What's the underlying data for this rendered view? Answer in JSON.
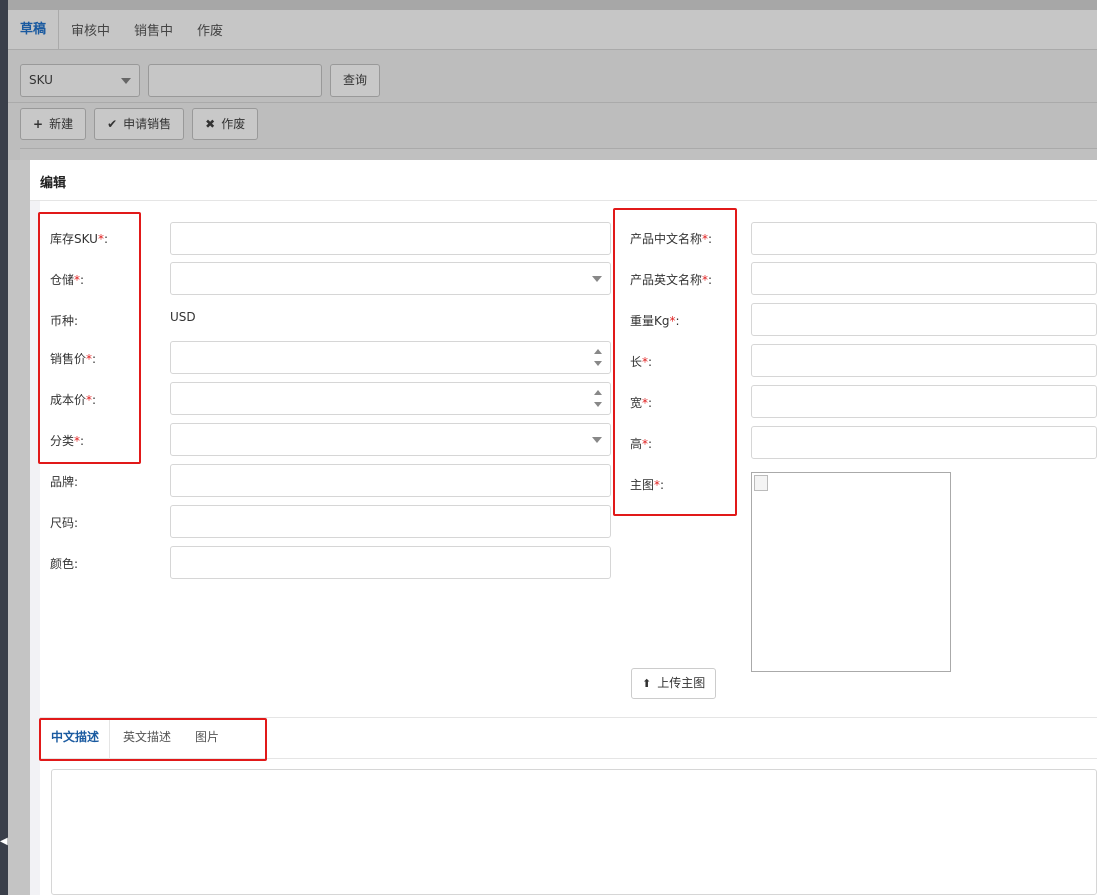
{
  "top_tabs": [
    "草稿",
    "审核中",
    "销售中",
    "作废"
  ],
  "search": {
    "field_select": "SKU",
    "query_value": "",
    "query_button": "查询"
  },
  "toolbar": {
    "new": "新建",
    "new_icon": "plus-icon",
    "apply": "申请销售",
    "apply_icon": "check-icon",
    "void": "作废",
    "void_icon": "x-icon"
  },
  "modal": {
    "title": "编辑",
    "left_fields": {
      "sku": {
        "label": "库存SKU",
        "required": "*",
        "colon": ":",
        "value": ""
      },
      "warehouse": {
        "label": "仓储",
        "required": "*",
        "colon": ":",
        "value": ""
      },
      "currency": {
        "label": "币种",
        "colon": ":",
        "value": "USD"
      },
      "sale_price": {
        "label": "销售价",
        "required": "*",
        "colon": ":",
        "value": ""
      },
      "cost_price": {
        "label": "成本价",
        "required": "*",
        "colon": ":",
        "value": ""
      },
      "category": {
        "label": "分类",
        "required": "*",
        "colon": ":",
        "value": ""
      },
      "brand": {
        "label": "品牌",
        "colon": ":",
        "value": ""
      },
      "size": {
        "label": "尺码",
        "colon": ":",
        "value": ""
      },
      "color": {
        "label": "颜色",
        "colon": ":",
        "value": ""
      }
    },
    "right_fields": {
      "name_cn": {
        "label": "产品中文名称",
        "required": "*",
        "colon": ":",
        "value": ""
      },
      "name_en": {
        "label": "产品英文名称",
        "required": "*",
        "colon": ":",
        "value": ""
      },
      "weight": {
        "label": "重量Kg",
        "required": "*",
        "colon": ":",
        "value": ""
      },
      "length": {
        "label": "长",
        "required": "*",
        "colon": ":",
        "value": ""
      },
      "width": {
        "label": "宽",
        "required": "*",
        "colon": ":",
        "value": ""
      },
      "height": {
        "label": "高",
        "required": "*",
        "colon": ":",
        "value": ""
      },
      "main_image": {
        "label": "主图",
        "required": "*",
        "colon": ":"
      }
    },
    "upload_button": "上传主图",
    "upload_icon": "upload-icon",
    "desc_tabs": [
      "中文描述",
      "英文描述",
      "图片"
    ],
    "description": ""
  },
  "colors": {
    "accent": "#1a5aa0",
    "required": "#e02020",
    "highlight_box": "#e11919"
  }
}
